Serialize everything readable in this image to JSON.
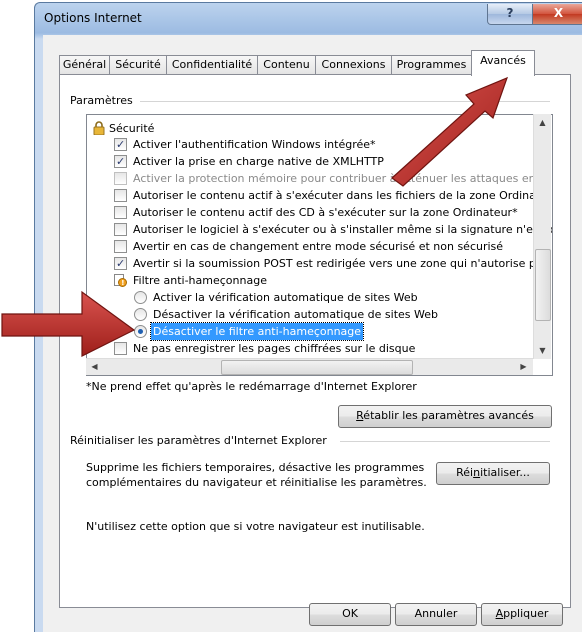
{
  "window": {
    "title": "Options Internet",
    "help_label": "?",
    "close_label": "X"
  },
  "tabs": [
    {
      "label": "Général"
    },
    {
      "label": "Sécurité"
    },
    {
      "label": "Confidentialité"
    },
    {
      "label": "Contenu"
    },
    {
      "label": "Connexions"
    },
    {
      "label": "Programmes"
    },
    {
      "label": "Avancés"
    }
  ],
  "settings_group": {
    "label": "Paramètres"
  },
  "tree": {
    "category": "Sécurité",
    "items": [
      {
        "text": "Activer l'authentification Windows intégrée*",
        "checked": true
      },
      {
        "text": "Activer la prise en charge native de XMLHTTP",
        "checked": true
      },
      {
        "text": "Activer la protection mémoire pour contribuer à atténuer les attaques en li",
        "checked": false,
        "disabled": true
      },
      {
        "text": "Autoriser le contenu actif à s'exécuter dans les fichiers de la zone Ordinate",
        "checked": false
      },
      {
        "text": "Autoriser le contenu actif des CD à s'exécuter sur la zone Ordinateur*",
        "checked": false
      },
      {
        "text": "Autoriser le logiciel à s'exécuter ou à s'installer même si la signature n'est p",
        "checked": false
      },
      {
        "text": "Avertir en cas de changement entre mode sécurisé et non sécurisé",
        "checked": false
      },
      {
        "text": "Avertir si la soumission POST est redirigée vers une zone qui n'autorise pas",
        "checked": true
      }
    ],
    "phishing_category": "Filtre anti-hameçonnage",
    "phishing_options": [
      {
        "text": "Activer la vérification automatique de sites Web",
        "checked": false
      },
      {
        "text": "Désactiver la vérification automatique de sites Web",
        "checked": false
      },
      {
        "text": "Désactiver le filtre anti-hameçonnage",
        "checked": true
      }
    ],
    "last_item": {
      "text": "Ne pas enregistrer les pages chiffrées sur le disque",
      "checked": false
    }
  },
  "restart_note": "*Ne prend effet qu'après le redémarrage d'Internet Explorer",
  "restore_button": {
    "accel": "R",
    "rest": "établir les paramètres avancés"
  },
  "reset_group": {
    "label": "Réinitialiser les paramètres d'Internet Explorer",
    "description_line1": "Supprime les fichiers temporaires, désactive les programmes",
    "description_line2": "complémentaires du navigateur et réinitialise les paramètres.",
    "reset_button": {
      "before": "Réi",
      "accel": "n",
      "after": "itialiser..."
    },
    "warning": "N'utilisez cette option que si votre navigateur est inutilisable."
  },
  "footer": {
    "ok": "OK",
    "cancel": "Annuler",
    "apply": {
      "accel": "A",
      "rest": "ppliquer"
    }
  },
  "colors": {
    "annotation_arrow": "#c0392b",
    "selection": "#3399ff"
  }
}
